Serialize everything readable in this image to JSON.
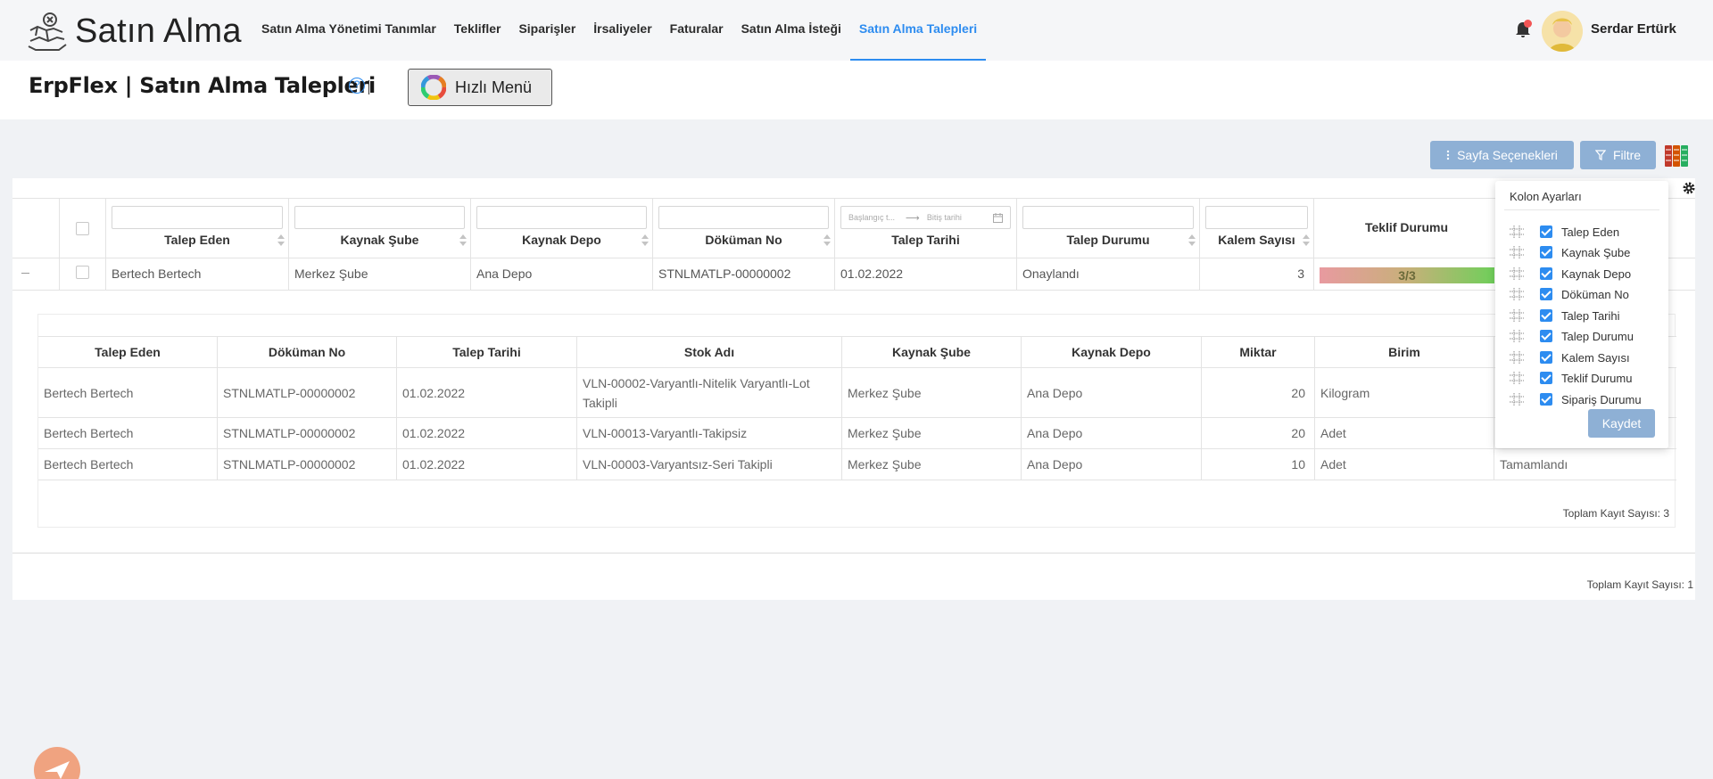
{
  "app": {
    "name": "Satın Alma"
  },
  "nav": [
    {
      "label": "Satın Alma Yönetimi Tanımlar",
      "active": false
    },
    {
      "label": "Teklifler",
      "active": false
    },
    {
      "label": "Siparişler",
      "active": false
    },
    {
      "label": "İrsaliyeler",
      "active": false
    },
    {
      "label": "Faturalar",
      "active": false
    },
    {
      "label": "Satın Alma İsteği",
      "active": false
    },
    {
      "label": "Satın Alma Talepleri",
      "active": true
    }
  ],
  "user": {
    "name": "Serdar Ertürk"
  },
  "colors": {
    "accent": "#2d8cf0",
    "button": "#8eb0d5",
    "badge": "#f25555"
  },
  "page": {
    "title": "ErpFlex | Satın Alma Talepleri",
    "quick_menu": "Hızlı Menü"
  },
  "toolbar": {
    "page_options": "Sayfa Seçenekleri",
    "filter": "Filtre"
  },
  "grid": {
    "columns": [
      "Talep Eden",
      "Kaynak Şube",
      "Kaynak Depo",
      "Döküman No",
      "Talep Tarihi",
      "Talep Durumu",
      "Kalem Sayısı",
      "Teklif Durumu"
    ],
    "date_filter": {
      "start_placeholder": "Başlangıç t...",
      "end_placeholder": "Bitiş tarihi"
    },
    "row": {
      "talep_eden": "Bertech Bertech",
      "kaynak_sube": "Merkez Şube",
      "kaynak_depo": "Ana Depo",
      "dokuman_no": "STNLMATLP-00000002",
      "talep_tarihi": "01.02.2022",
      "talep_durumu": "Onaylandı",
      "kalem_sayisi": "3",
      "teklif_durumu": "3/3"
    },
    "total": "Toplam Kayıt Sayısı: 1"
  },
  "detail": {
    "columns": [
      "Talep Eden",
      "Döküman No",
      "Talep Tarihi",
      "Stok Adı",
      "Kaynak Şube",
      "Kaynak Depo",
      "Miktar",
      "Birim"
    ],
    "rows": [
      [
        "Bertech Bertech",
        "STNLMATLP-00000002",
        "01.02.2022",
        "VLN-00002-Varyantlı-Nitelik Varyantlı-Lot Takipli",
        "Merkez Şube",
        "Ana Depo",
        "20",
        "Kilogram",
        ""
      ],
      [
        "Bertech Bertech",
        "STNLMATLP-00000002",
        "01.02.2022",
        "VLN-00013-Varyantlı-Takipsiz",
        "Merkez Şube",
        "Ana Depo",
        "20",
        "Adet",
        ""
      ],
      [
        "Bertech Bertech",
        "STNLMATLP-00000002",
        "01.02.2022",
        "VLN-00003-Varyantsız-Seri Takipli",
        "Merkez Şube",
        "Ana Depo",
        "10",
        "Adet",
        "Tamamlandı"
      ]
    ],
    "total": "Toplam Kayıt Sayısı: 3"
  },
  "column_settings": {
    "title": "Kolon Ayarları",
    "items": [
      "Talep Eden",
      "Kaynak Şube",
      "Kaynak Depo",
      "Döküman No",
      "Talep Tarihi",
      "Talep Durumu",
      "Kalem Sayısı",
      "Teklif Durumu",
      "Sipariş Durumu"
    ],
    "save": "Kaydet"
  }
}
